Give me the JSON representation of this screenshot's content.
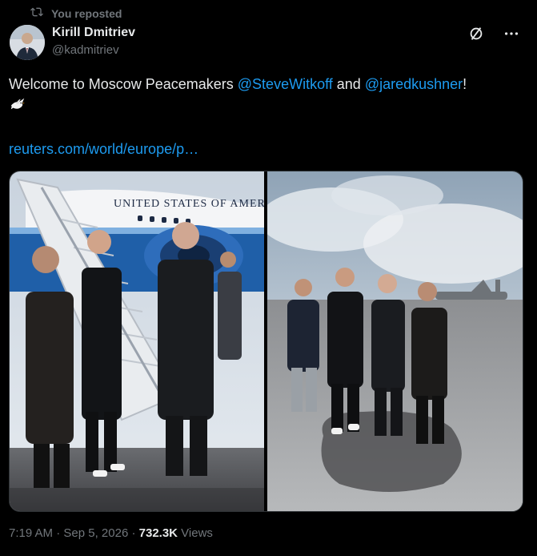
{
  "repost": {
    "label": "You reposted"
  },
  "author": {
    "display_name": "Kirill Dmitriev",
    "handle": "@kadmitriev"
  },
  "tweet": {
    "text_prefix": "Welcome to Moscow Peacemakers ",
    "mention1": "@SteveWitkoff",
    "text_and": " and ",
    "mention2": "@jaredkushner",
    "text_suffix": "!",
    "link_text": "reuters.com/world/europe/p…"
  },
  "media": {
    "photo1_plane_text": "UNITED STATES OF AMERICA"
  },
  "meta": {
    "time": "7:19 AM",
    "sep1": " · ",
    "date": "Sep 5, 2026",
    "sep2": " · ",
    "views_count": "732.3K",
    "views_label": " Views"
  },
  "colors": {
    "accent": "#1d9bf0",
    "secondary_text": "#71767b",
    "primary_text": "#e7e9ea",
    "background": "#000000"
  },
  "icons": [
    "repost-icon",
    "grok-icon",
    "more-icon",
    "dove-emoji"
  ]
}
